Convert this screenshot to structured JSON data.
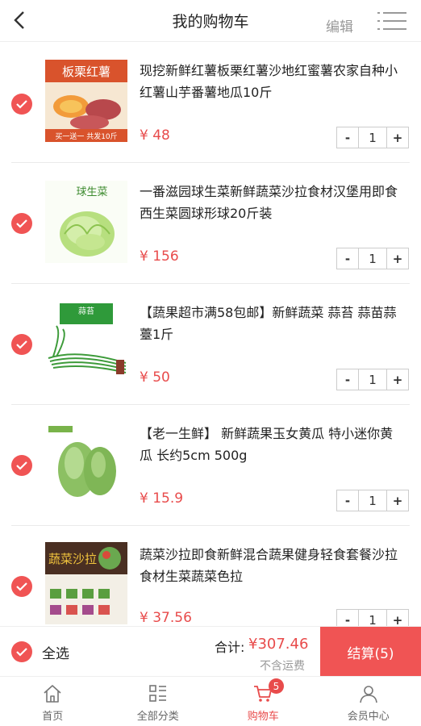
{
  "header": {
    "title": "我的购物车",
    "edit_label": "编辑"
  },
  "items": [
    {
      "name": "现挖新鲜红薯板栗红薯沙地红蜜薯农家自种小红薯山芋番薯地瓜10斤",
      "price": "¥ 48",
      "qty": "1",
      "thumb_icon": "sweet-potato-image",
      "thumb_title": "板栗红薯",
      "thumb_sub": "买一送一 共发10斤"
    },
    {
      "name": "一番滋园球生菜新鲜蔬菜沙拉食材汉堡用即食西生菜圆球形球20斤装",
      "price": "¥ 156",
      "qty": "1",
      "thumb_icon": "lettuce-image",
      "thumb_title": "球生菜"
    },
    {
      "name": "【蔬果超市满58包邮】新鲜蔬菜 蒜苔 蒜苗蒜薹1斤",
      "price": "¥ 50",
      "qty": "1",
      "thumb_icon": "garlic-sprout-image",
      "thumb_title": "蒜苔"
    },
    {
      "name": "【老一生鲜】 新鲜蔬果玉女黄瓜 特小迷你黄瓜 长约5cm 500g",
      "price": "¥ 15.9",
      "qty": "1",
      "thumb_icon": "cucumber-image"
    },
    {
      "name": "蔬菜沙拉即食新鲜混合蔬果健身轻食套餐沙拉食材生菜蔬菜色拉",
      "price": "¥ 37.56",
      "qty": "1",
      "thumb_icon": "salad-image",
      "thumb_title": "蔬菜沙拉"
    }
  ],
  "stepper": {
    "minus": "-",
    "plus": "+"
  },
  "footer": {
    "select_all": "全选",
    "total_label": "合计:",
    "total_value": "¥307.46",
    "shipping_note": "不含运费",
    "checkout_label": "结算(5)"
  },
  "tabs": [
    {
      "label": "首页",
      "icon": "home-icon"
    },
    {
      "label": "全部分类",
      "icon": "category-icon"
    },
    {
      "label": "购物车",
      "icon": "cart-icon",
      "active": true,
      "badge": "5"
    },
    {
      "label": "会员中心",
      "icon": "user-icon"
    }
  ],
  "colors": {
    "accent": "#f05454",
    "price": "#e84b4b",
    "muted": "#999999"
  }
}
